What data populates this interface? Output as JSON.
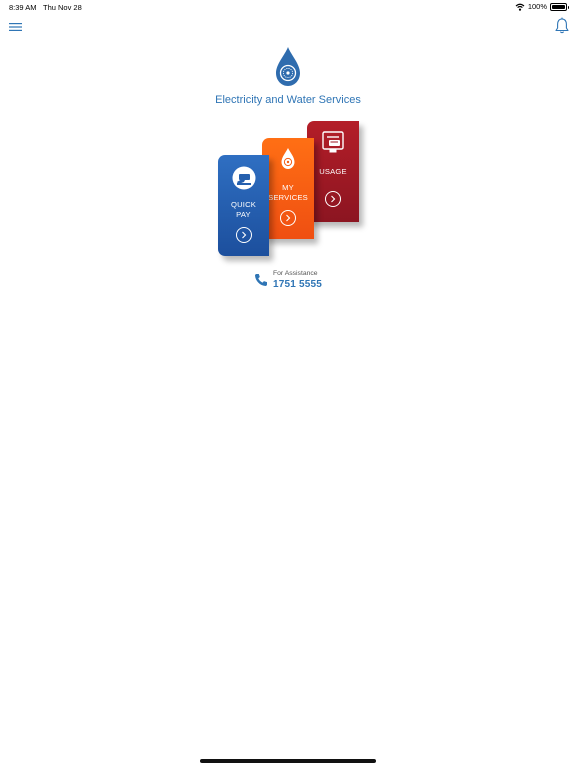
{
  "status_bar": {
    "time": "8:39 AM",
    "date": "Thu Nov 28",
    "battery": "100%",
    "battery_level": 1.0
  },
  "nav": {
    "menu_icon": "hamburger-menu-icon",
    "notifications_icon": "bell-icon"
  },
  "brand": {
    "title": "Electricity and Water Services",
    "logo_icon": "water-drop-logo-icon"
  },
  "cards": {
    "usage": {
      "label": "USAGE",
      "icon": "bill-device-icon",
      "color": "#9f1a25"
    },
    "my_services": {
      "label_line1": "MY",
      "label_line2": "SERVICES",
      "icon": "droplet-badge-icon",
      "color": "#f55d13"
    },
    "quick_pay": {
      "label_line1": "QUICK",
      "label_line2": "PAY",
      "icon": "pay-hand-icon",
      "color": "#2660ae"
    }
  },
  "assistance": {
    "label": "For Assistance",
    "phone": "1751 5555",
    "icon": "phone-icon"
  },
  "colors": {
    "accent": "#2f75b5"
  }
}
